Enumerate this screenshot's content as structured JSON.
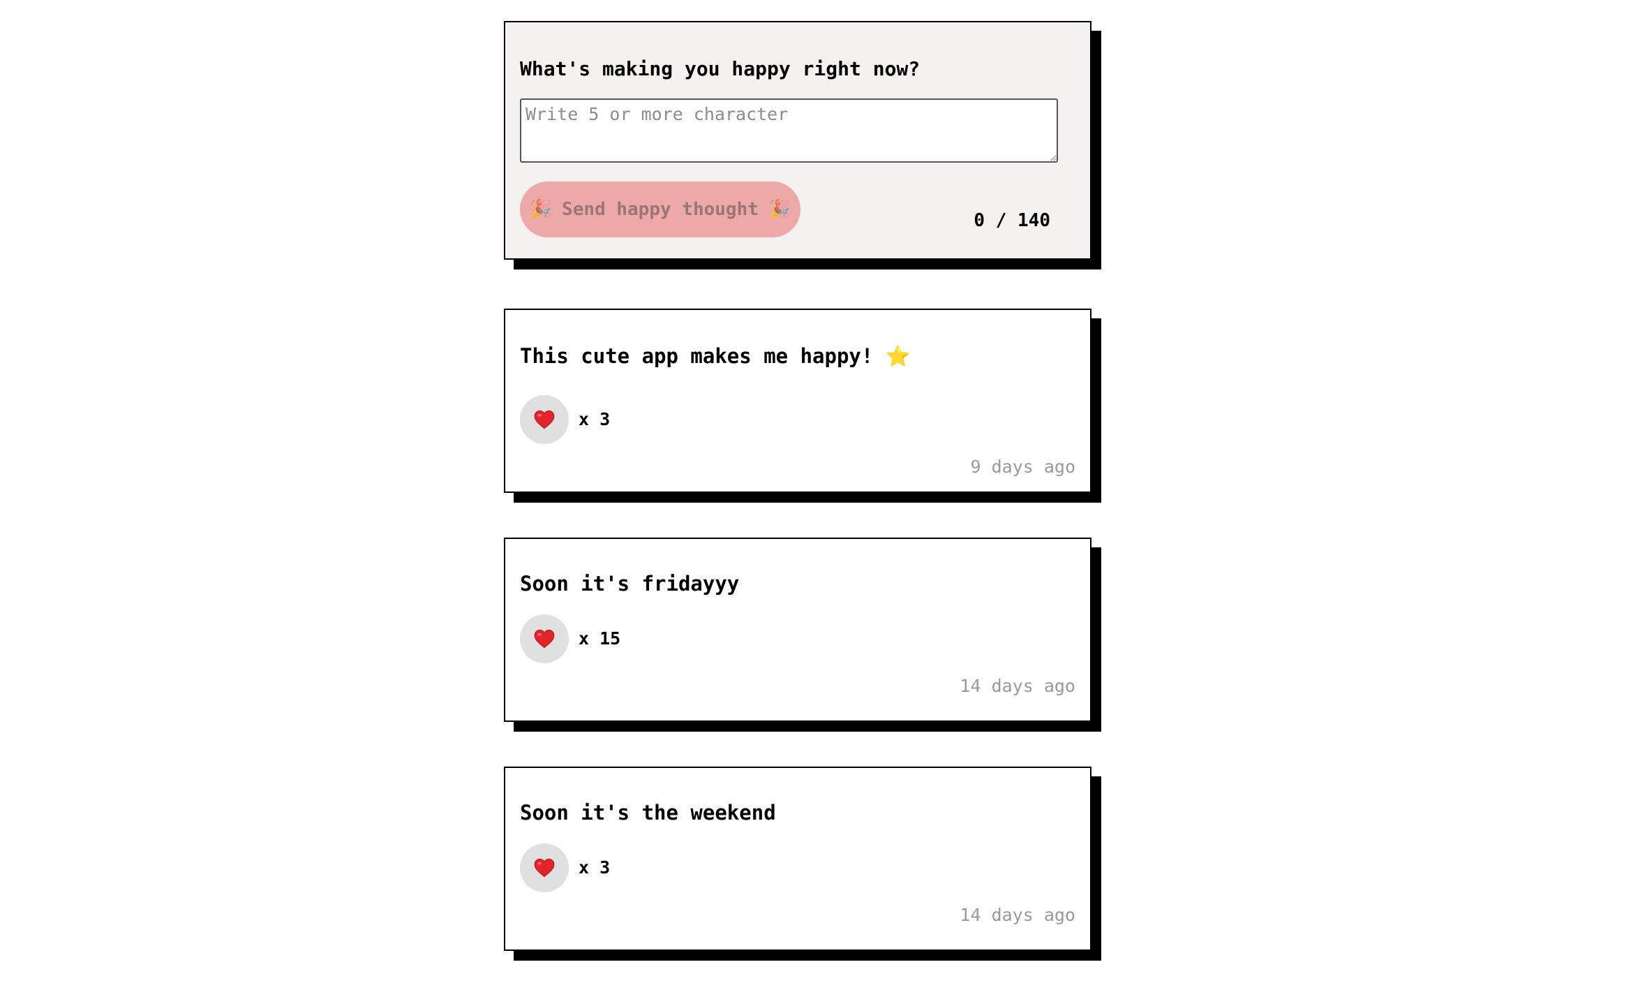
{
  "composer": {
    "question": "What's making you happy right now?",
    "placeholder": "Write 5 or more character",
    "value": "",
    "send_label": "Send happy thought",
    "send_icon": "party-popper-icon",
    "char_count": "0 / 140"
  },
  "thoughts": [
    {
      "message": "This cute app makes me happy! ⭐",
      "like_icon": "heart-icon",
      "likes": "x 3",
      "time": "9 days ago"
    },
    {
      "message": "Soon it's fridayyy",
      "like_icon": "heart-icon",
      "likes": "x 15",
      "time": "14 days ago"
    },
    {
      "message": "Soon it's the weekend",
      "like_icon": "heart-icon",
      "likes": "x 3",
      "time": "14 days ago"
    }
  ],
  "colors": {
    "composer_bg": "#f3f2f0",
    "send_button_bg": "#eda9a8",
    "like_button_bg": "#e0e0e0",
    "timestamp": "#9a9a9a",
    "shadow": "#000000"
  }
}
